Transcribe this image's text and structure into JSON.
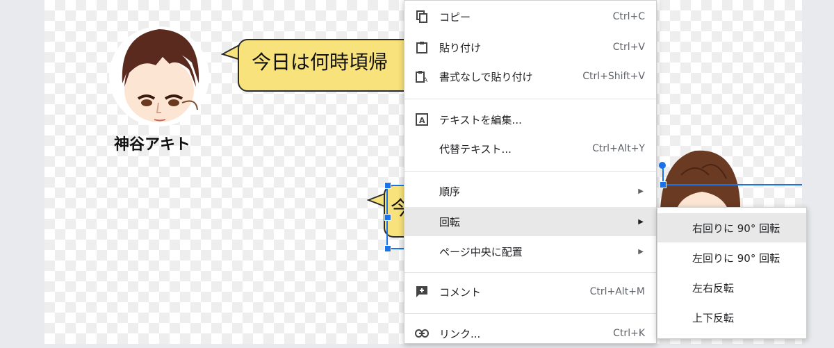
{
  "canvas": {
    "person1": {
      "name": "神谷アキト",
      "bubble_text": "今日は何時頃帰"
    },
    "bubble2_text": "今"
  },
  "context_menu": {
    "items": [
      {
        "label": "コピー",
        "shortcut": "Ctrl+C",
        "icon": "copy-icon"
      },
      {
        "label": "貼り付け",
        "shortcut": "Ctrl+V",
        "icon": "paste-icon"
      },
      {
        "label": "書式なしで貼り付け",
        "shortcut": "Ctrl+Shift+V",
        "icon": "paste-plain-icon"
      },
      {
        "label": "テキストを編集...",
        "shortcut": "",
        "icon": "edit-text-icon"
      },
      {
        "label": "代替テキスト...",
        "shortcut": "Ctrl+Alt+Y",
        "icon": ""
      },
      {
        "label": "順序",
        "shortcut": "",
        "icon": ""
      },
      {
        "label": "回転",
        "shortcut": "",
        "icon": ""
      },
      {
        "label": "ページ中央に配置",
        "shortcut": "",
        "icon": ""
      },
      {
        "label": "コメント",
        "shortcut": "Ctrl+Alt+M",
        "icon": "add-comment-icon"
      },
      {
        "label": "リンク...",
        "shortcut": "Ctrl+K",
        "icon": "link-icon"
      }
    ]
  },
  "rotate_submenu": {
    "items": [
      {
        "label": "右回りに 90° 回転"
      },
      {
        "label": "左回りに 90° 回転"
      },
      {
        "label": "左右反転"
      },
      {
        "label": "上下反転"
      }
    ]
  },
  "colors": {
    "bubble": "#f7e27c",
    "selection": "#1a73e8",
    "menu_highlight": "#e8e8e8"
  }
}
